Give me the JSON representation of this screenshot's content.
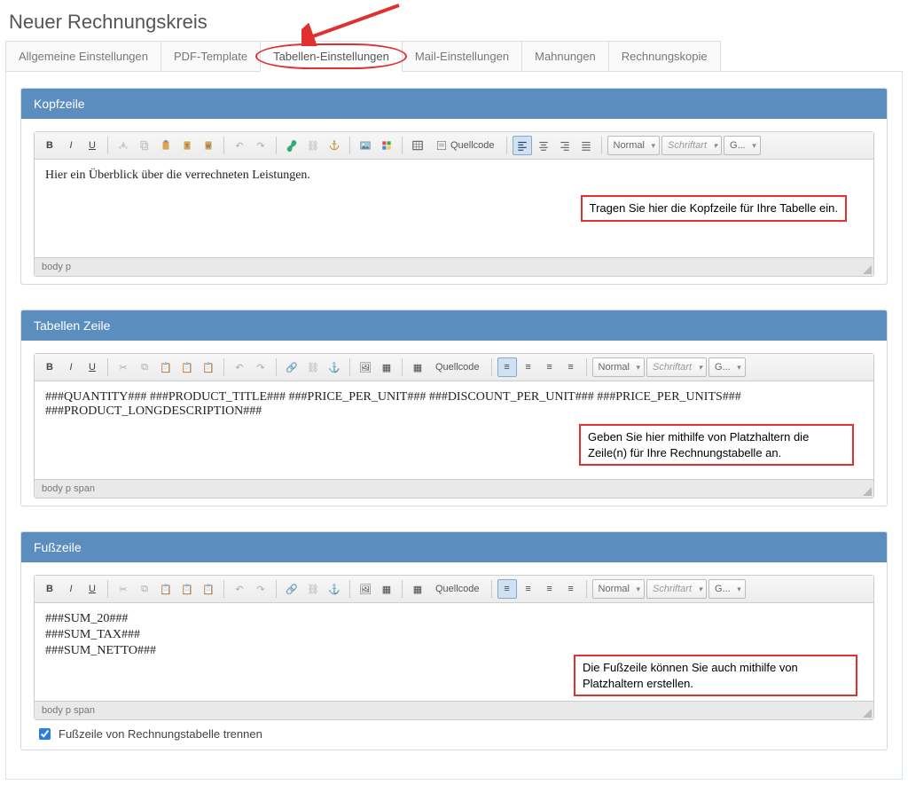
{
  "page_title": "Neuer Rechnungskreis",
  "tabs": [
    {
      "label": "Allgemeine Einstellungen",
      "active": false
    },
    {
      "label": "PDF-Template",
      "active": false
    },
    {
      "label": "Tabellen-Einstellungen",
      "active": true,
      "highlighted": true
    },
    {
      "label": "Mail-Einstellungen",
      "active": false
    },
    {
      "label": "Mahnungen",
      "active": false
    },
    {
      "label": "Rechnungskopie",
      "active": false
    }
  ],
  "toolbar": {
    "source_label": "Quellcode",
    "format_select": "Normal",
    "font_select": "Schriftart",
    "size_select": "G..."
  },
  "sections": {
    "kopfzeile": {
      "title": "Kopfzeile",
      "content": "Hier ein Überblick über die verrechneten Leistungen.",
      "callout": "Tragen Sie hier die Kopfzeile für Ihre Tabelle ein.",
      "path": "body  p"
    },
    "tabellenzeile": {
      "title": "Tabellen Zeile",
      "content": "###QUANTITY### ###PRODUCT_TITLE### ###PRICE_PER_UNIT### ###DISCOUNT_PER_UNIT### ###PRICE_PER_UNITS### ###PRODUCT_LONGDESCRIPTION###",
      "callout": "Geben Sie hier mithilfe von Platzhaltern die Zeile(n) für Ihre Rechnungstabelle an.",
      "path": "body  p  span"
    },
    "fusszeile": {
      "title": "Fußzeile",
      "content_lines": [
        "###SUM_20###",
        "###SUM_TAX###",
        "###SUM_NETTO###"
      ],
      "callout": "Die Fußzeile können Sie auch mithilfe von Platzhaltern erstellen.",
      "path": "body  p  span"
    }
  },
  "checkbox": {
    "label": "Fußzeile von Rechnungstabelle trennen",
    "checked": true
  }
}
